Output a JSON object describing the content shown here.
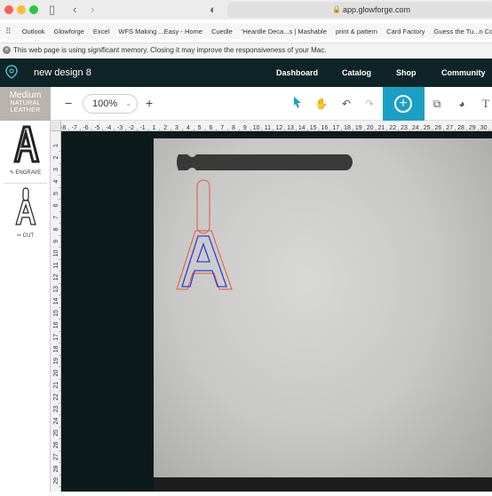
{
  "browser": {
    "url": "app.glowforge.com",
    "bookmarks": [
      "Outlook",
      "Glowforge",
      "Excel",
      "WFS Making ...Easy - Home",
      "Cuedle",
      "'Heardle Deca...s | Mashable",
      "print & pattern",
      "Card Factory",
      "Guess the Tu...n Colmanweb"
    ],
    "memory_warning": "This web page is using significant memory. Closing it may improve the responsiveness of your Mac."
  },
  "app": {
    "design_name": "new design 8",
    "nav": [
      "Dashboard",
      "Catalog",
      "Shop",
      "Community"
    ]
  },
  "toolbar": {
    "material_title": "Medium",
    "material_sub1": "NATURAL",
    "material_sub2": "LEATHER",
    "zoom": "100%",
    "tools": [
      "select-arrow-icon",
      "hand-pan-icon",
      "undo-icon",
      "redo-icon",
      "add-icon",
      "copy-icon",
      "shapes-icon",
      "text-icon"
    ]
  },
  "steps": [
    {
      "glyph": "A",
      "label": "ENGRAVE"
    },
    {
      "glyph": "A",
      "label": "CUT"
    }
  ],
  "ruler": {
    "top": [
      "-8",
      "-7",
      "-6",
      "-5",
      "-4",
      "-3",
      "-2",
      "-1",
      "1",
      "2",
      "3",
      "4",
      "5",
      "6",
      "7",
      "8",
      "9",
      "10",
      "11",
      "12",
      "13",
      "14",
      "15",
      "16",
      "17",
      "18",
      "19",
      "20",
      "21",
      "22",
      "23",
      "24",
      "25",
      "26",
      "27",
      "28",
      "29",
      "30"
    ],
    "left": [
      "1",
      "2",
      "3",
      "4",
      "5",
      "6",
      "7",
      "8",
      "9",
      "10",
      "11",
      "12",
      "13",
      "14",
      "15",
      "16",
      "17",
      "18",
      "19",
      "20",
      "21",
      "22",
      "23",
      "24",
      "25",
      "26",
      "27",
      "28",
      "29"
    ]
  },
  "colors": {
    "nav_bg": "#0e2427",
    "accent": "#1b9fc5",
    "engrave_path": "#3140d8",
    "cut_path": "#e8563a"
  }
}
